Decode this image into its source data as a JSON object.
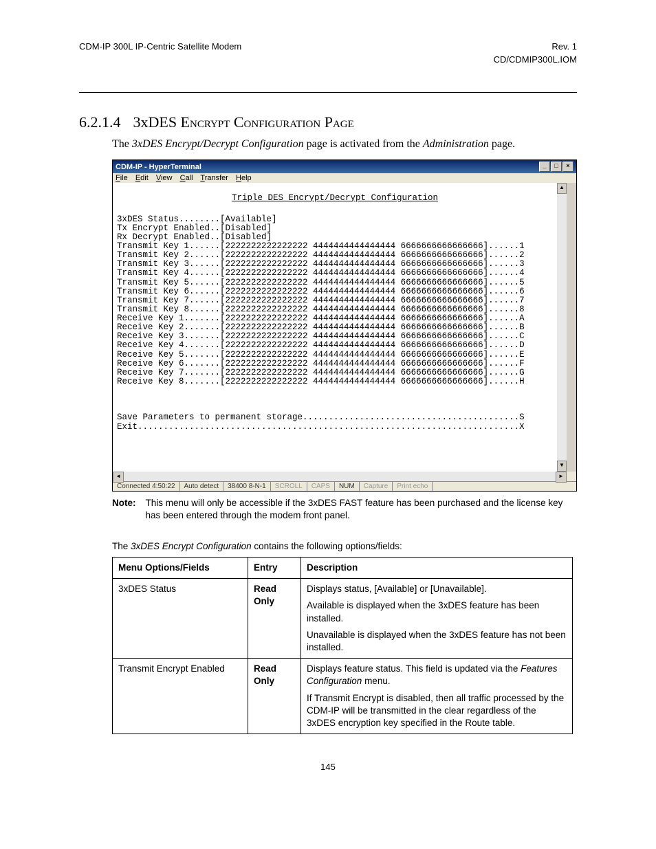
{
  "header": {
    "left": "CDM-IP 300L IP-Centric Satellite Modem",
    "right1": "Rev. 1",
    "right2": "CD/CDMIP300L.IOM"
  },
  "section": {
    "number": "6.2.1.4",
    "title": "3xDES Encrypt Configuration Page",
    "body_pre": "The ",
    "body_ital1": "3xDES Encrypt/Decrypt Configuration",
    "body_mid": " page is activated from the ",
    "body_ital2": "Administration",
    "body_post": " page."
  },
  "terminal": {
    "title": "CDM-IP - HyperTerminal",
    "menu": {
      "file": "File",
      "edit": "Edit",
      "view": "View",
      "call": "Call",
      "transfer": "Transfer",
      "help": "Help"
    },
    "screen_title": "Triple DES Encrypt/Decrypt Configuration",
    "status_lines": [
      "3xDES Status........[Available]",
      "Tx Encrypt Enabled..[Disabled]",
      "Rx Decrypt Enabled..[Disabled]"
    ],
    "key_lines": [
      "Transmit Key 1......[2222222222222222 4444444444444444 6666666666666666]......1",
      "Transmit Key 2......[2222222222222222 4444444444444444 6666666666666666]......2",
      "Transmit Key 3......[2222222222222222 4444444444444444 6666666666666666]......3",
      "Transmit Key 4......[2222222222222222 4444444444444444 6666666666666666]......4",
      "Transmit Key 5......[2222222222222222 4444444444444444 6666666666666666]......5",
      "Transmit Key 6......[2222222222222222 4444444444444444 6666666666666666]......6",
      "Transmit Key 7......[2222222222222222 4444444444444444 6666666666666666]......7",
      "Transmit Key 8......[2222222222222222 4444444444444444 6666666666666666]......8",
      "Receive Key 1.......[2222222222222222 4444444444444444 6666666666666666]......A",
      "Receive Key 2.......[2222222222222222 4444444444444444 6666666666666666]......B",
      "Receive Key 3.......[2222222222222222 4444444444444444 6666666666666666]......C",
      "Receive Key 4.......[2222222222222222 4444444444444444 6666666666666666]......D",
      "Receive Key 5.......[2222222222222222 4444444444444444 6666666666666666]......E",
      "Receive Key 6.......[2222222222222222 4444444444444444 6666666666666666]......F",
      "Receive Key 7.......[2222222222222222 4444444444444444 6666666666666666]......G",
      "Receive Key 8.......[2222222222222222 4444444444444444 6666666666666666]......H"
    ],
    "footer_lines": [
      "Save Parameters to permanent storage..........................................S",
      "Exit..........................................................................X"
    ],
    "status": {
      "conn": "Connected 4:50:22",
      "auto": "Auto detect",
      "port": "38400 8-N-1",
      "scroll": "SCROLL",
      "caps": "CAPS",
      "num": "NUM",
      "capture": "Capture",
      "echo": "Print echo"
    }
  },
  "note": {
    "label": "Note:",
    "text": "This menu will only be accessible if the 3xDES FAST feature has been purchased and the license key has been entered through the modem front panel."
  },
  "intro": {
    "pre": "The ",
    "ital": "3xDES Encrypt Configuration",
    "post": " contains the following options/fields:"
  },
  "table": {
    "h1": "Menu Options/Fields",
    "h2": "Entry",
    "h3": "Description",
    "rows": [
      {
        "field": "3xDES Status",
        "entry": "Read Only",
        "desc": [
          {
            "t": "Displays status, [Available] or [Unavailable]."
          },
          {
            "t": "Available is displayed when the 3xDES feature has been installed."
          },
          {
            "t": "Unavailable is displayed when the 3xDES feature has not been installed."
          }
        ]
      },
      {
        "field": "Transmit Encrypt Enabled",
        "entry": "Read Only",
        "desc": [
          {
            "pre": "Displays feature status. This field is updated via the ",
            "ital": "Features Configuration",
            "post": " menu."
          },
          {
            "t": "If Transmit Encrypt is disabled, then all traffic processed by the CDM-IP will be transmitted in the clear regardless of the 3xDES encryption key specified in the Route table."
          }
        ]
      }
    ]
  },
  "page_number": "145"
}
